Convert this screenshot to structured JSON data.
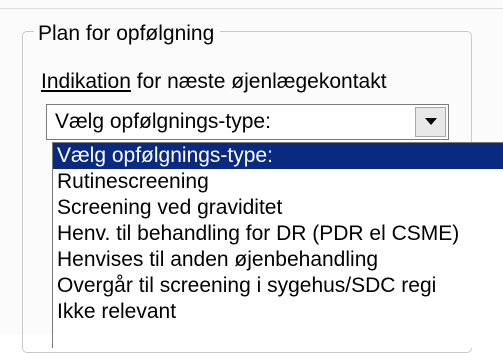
{
  "group": {
    "title": "Plan for opfølgning"
  },
  "indication": {
    "label_mnemonic": "Indikation",
    "label_rest": " for næste øjenlægekontakt"
  },
  "combo": {
    "value": "Vælg opfølgnings-type:",
    "button_icon": "chevron-down-icon"
  },
  "dropdown": {
    "selected_index": 0,
    "selection_color": "#0a2a82",
    "items": [
      {
        "label": "Vælg opfølgnings-type:"
      },
      {
        "label": "Rutinescreening"
      },
      {
        "label": "Screening ved graviditet"
      },
      {
        "label": "Henv. til behandling for DR (PDR el CSME)"
      },
      {
        "label": "Henvises til anden øjenbehandling"
      },
      {
        "label": "Overgår til screening i sygehus/SDC regi"
      },
      {
        "label": "Ikke relevant"
      }
    ]
  }
}
